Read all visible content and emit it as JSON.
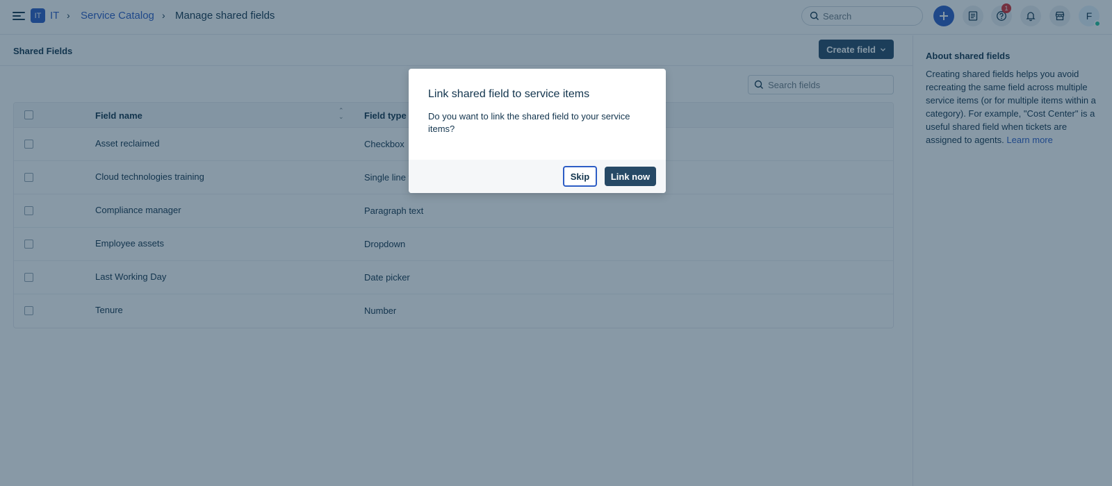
{
  "header": {
    "workspace_badge": "IT",
    "breadcrumb": [
      "IT",
      "Service Catalog",
      "Manage shared fields"
    ],
    "search_placeholder": "Search",
    "notification_count": "1",
    "avatar_initial": "F"
  },
  "main": {
    "title": "Shared Fields",
    "create_button": "Create field",
    "search_placeholder": "Search fields",
    "columns": [
      "Field name",
      "Field type"
    ],
    "rows": [
      {
        "name": "Asset reclaimed",
        "type": "Checkbox"
      },
      {
        "name": "Cloud technologies training",
        "type": "Single line text"
      },
      {
        "name": "Compliance manager",
        "type": "Paragraph text"
      },
      {
        "name": "Employee assets",
        "type": "Dropdown"
      },
      {
        "name": "Last Working Day",
        "type": "Date picker"
      },
      {
        "name": "Tenure",
        "type": "Number"
      }
    ]
  },
  "aside": {
    "title": "About shared fields",
    "body": "Creating shared fields helps you avoid recreating the same field across multiple service items (or for multiple items within a category). For example, \"Cost Center\" is a useful shared field when tickets are assigned to agents.",
    "link": "Learn more"
  },
  "modal": {
    "title": "Link shared field to service items",
    "body": "Do you want to link the shared field to your service items?",
    "skip_label": "Skip",
    "link_label": "Link now"
  },
  "colors": {
    "primary": "#264966",
    "accent": "#2c5cc5",
    "badge": "#d72d30",
    "presence": "#24c39a"
  }
}
